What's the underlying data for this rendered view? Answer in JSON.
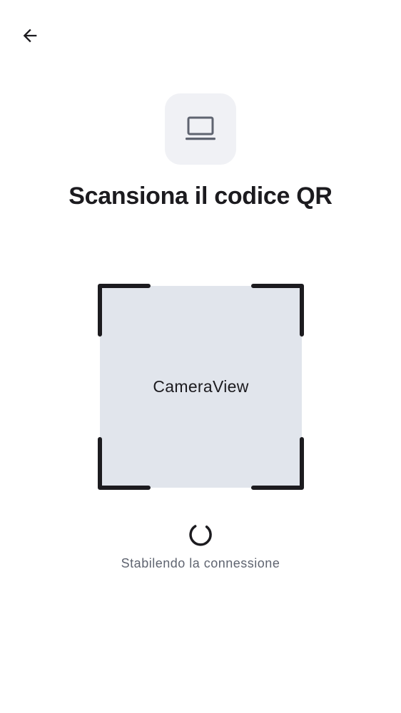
{
  "header": {
    "back_icon": "arrow-left-icon"
  },
  "device_badge": {
    "icon": "laptop-icon",
    "background": "#f0f1f5",
    "icon_color": "#5f6470"
  },
  "title": "Scansiona il codice QR",
  "scanner": {
    "camera_label": "CameraView",
    "frame_color": "#1c1b1f",
    "camera_background": "#e1e5ec"
  },
  "status": {
    "spinner_icon": "loading-spinner-icon",
    "text": "Stabilendo la connessione"
  }
}
